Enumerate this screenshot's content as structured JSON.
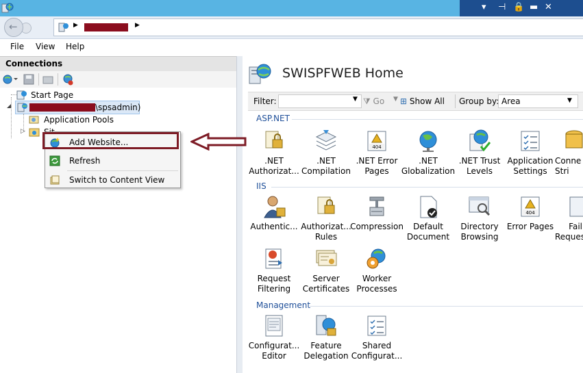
{
  "menu": {
    "file": "File",
    "view": "View",
    "help": "Help"
  },
  "connections": {
    "title": "Connections",
    "tree": {
      "start_page": "Start Page",
      "server_suffix": "\\spsadmin)",
      "app_pools": "Application Pools",
      "sites": "Sit"
    }
  },
  "context_menu": {
    "add_website": "Add Website...",
    "refresh": "Refresh",
    "switch_content": "Switch to Content View"
  },
  "main": {
    "title": "SWISPFWEB Home",
    "filter_label": "Filter:",
    "go_label": "Go",
    "show_all": "Show All",
    "group_by_label": "Group by:",
    "group_by_value": "Area",
    "sections": {
      "aspnet": "ASP.NET",
      "iis": "IIS",
      "management": "Management"
    },
    "features": {
      "net_auth": ".NET Authorizat...",
      "net_comp": ".NET Compilation",
      "net_err": ".NET Error Pages",
      "net_glob": ".NET Globalization",
      "net_trust": ".NET Trust Levels",
      "app_settings": "Application Settings",
      "conn_strings": "Conne Stri",
      "authentic": "Authentic...",
      "authoriz": "Authorizat... Rules",
      "compression": "Compression",
      "default_doc": "Default Document",
      "dir_browse": "Directory Browsing",
      "error_pages": "Error Pages",
      "failed_req": "Fail Reques",
      "req_filter": "Request Filtering",
      "server_certs": "Server Certificates",
      "worker_proc": "Worker Processes",
      "config_editor": "Configurat... Editor",
      "feature_deleg": "Feature Delegation",
      "shared_config": "Shared Configurat..."
    }
  },
  "colors": {
    "section": "#1f4f99",
    "annotation": "#7d1b25",
    "redaction": "#8b0d1e"
  }
}
